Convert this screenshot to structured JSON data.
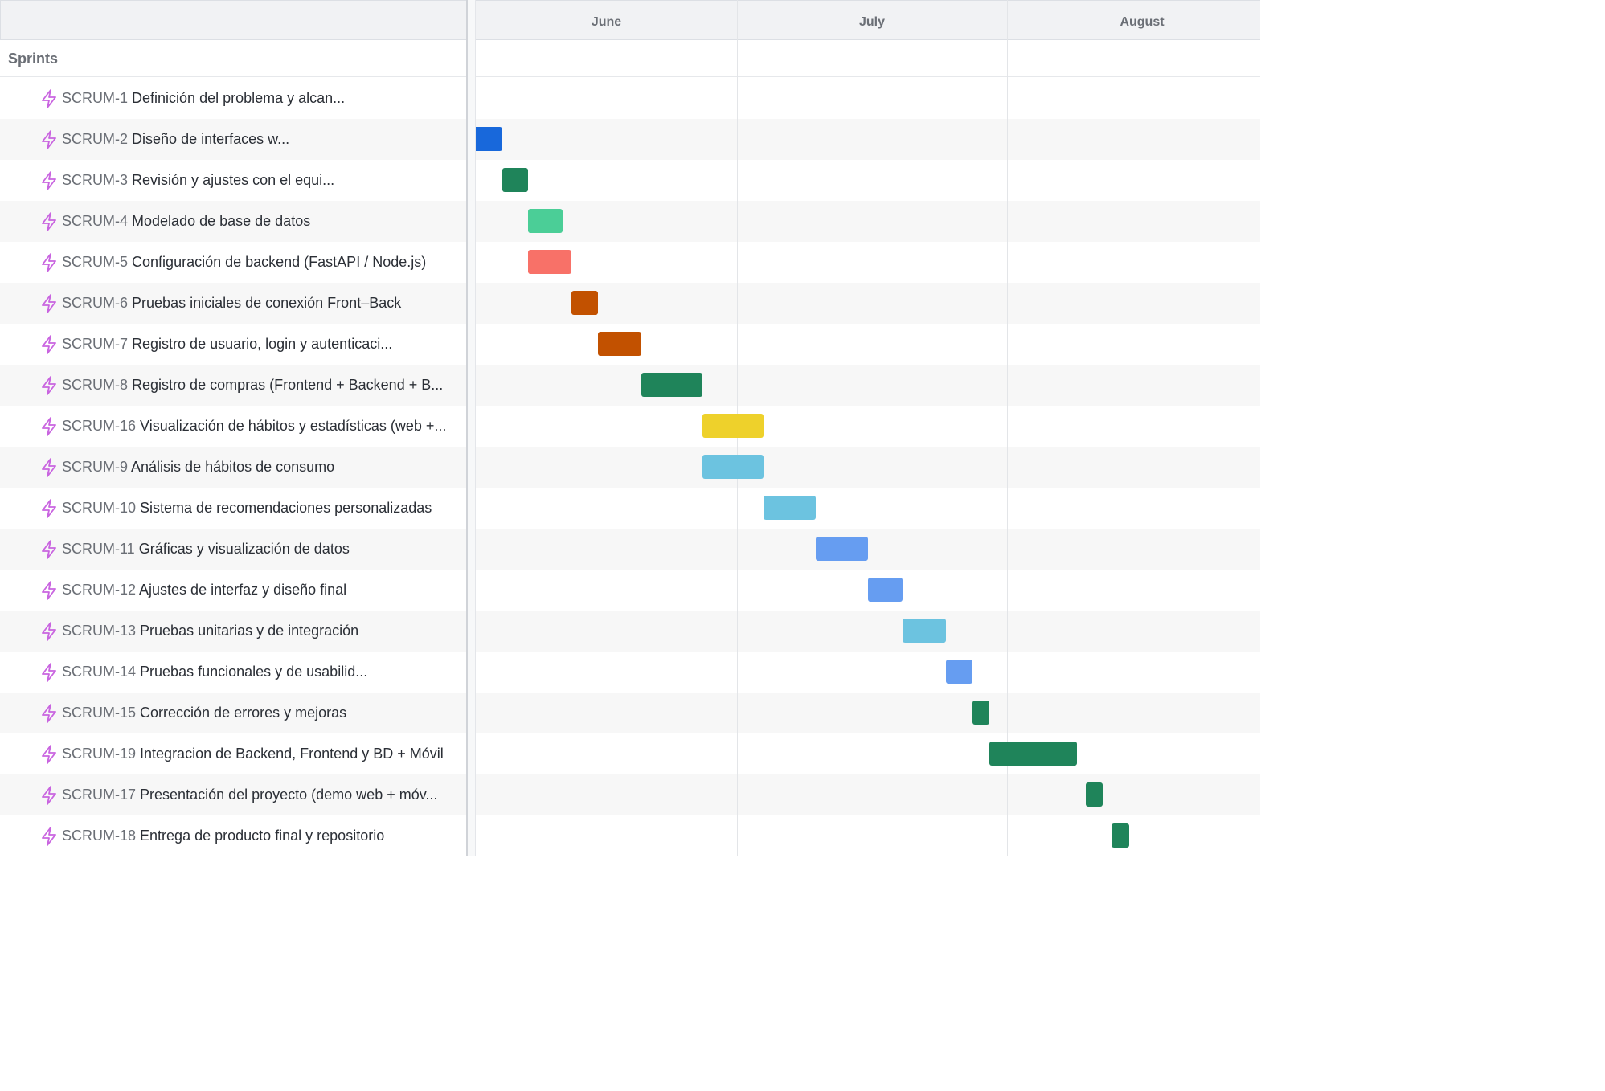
{
  "timeline": {
    "months": [
      "June",
      "July",
      "August"
    ],
    "section_title": "Sprints"
  },
  "issues": [
    {
      "key": "SCRUM-1",
      "title": "Definición del problema y alcan...",
      "start": "",
      "end": "",
      "color": ""
    },
    {
      "key": "SCRUM-2",
      "title": "Diseño de interfaces w...",
      "start": "2025-05-31",
      "end": "2025-06-03",
      "color": "#1868db"
    },
    {
      "key": "SCRUM-3",
      "title": "Revisión y ajustes con el equi...",
      "start": "2025-06-04",
      "end": "2025-06-06",
      "color": "#1f845a"
    },
    {
      "key": "SCRUM-4",
      "title": "Modelado de base de datos",
      "start": "2025-06-07",
      "end": "2025-06-10",
      "color": "#4bce97"
    },
    {
      "key": "SCRUM-5",
      "title": "Configuración de backend (FastAPI / Node.js)",
      "start": "2025-06-07",
      "end": "2025-06-11",
      "color": "#f87168"
    },
    {
      "key": "SCRUM-6",
      "title": "Pruebas iniciales de conexión Front–Back",
      "start": "2025-06-12",
      "end": "2025-06-14",
      "color": "#c25100"
    },
    {
      "key": "SCRUM-7",
      "title": "Registro de usuario, login y autenticaci...",
      "start": "2025-06-15",
      "end": "2025-06-19",
      "color": "#c25100"
    },
    {
      "key": "SCRUM-8",
      "title": "Registro de compras (Frontend + Backend + B...",
      "start": "2025-06-20",
      "end": "2025-06-26",
      "color": "#1f845a"
    },
    {
      "key": "SCRUM-16",
      "title": "Visualización de hábitos y estadísticas (web +...",
      "start": "2025-06-27",
      "end": "2025-07-03",
      "color": "#eed12b"
    },
    {
      "key": "SCRUM-9",
      "title": "Análisis de hábitos de consumo",
      "start": "2025-06-27",
      "end": "2025-07-03",
      "color": "#6cc3e0"
    },
    {
      "key": "SCRUM-10",
      "title": "Sistema de recomendaciones personalizadas",
      "start": "2025-07-04",
      "end": "2025-07-09",
      "color": "#6cc3e0"
    },
    {
      "key": "SCRUM-11",
      "title": "Gráficas y visualización de datos",
      "start": "2025-07-10",
      "end": "2025-07-15",
      "color": "#669df1"
    },
    {
      "key": "SCRUM-12",
      "title": "Ajustes de interfaz y diseño final",
      "start": "2025-07-16",
      "end": "2025-07-19",
      "color": "#669df1"
    },
    {
      "key": "SCRUM-13",
      "title": "Pruebas unitarias y de integración",
      "start": "2025-07-20",
      "end": "2025-07-24",
      "color": "#6cc3e0"
    },
    {
      "key": "SCRUM-14",
      "title": "Pruebas funcionales y de usabilid...",
      "start": "2025-07-25",
      "end": "2025-07-27",
      "color": "#669df1"
    },
    {
      "key": "SCRUM-15",
      "title": "Corrección de errores y mejoras",
      "start": "2025-07-28",
      "end": "2025-07-29",
      "color": "#1f845a"
    },
    {
      "key": "SCRUM-19",
      "title": "Integracion de Backend, Frontend y BD + Móvil",
      "start": "2025-07-30",
      "end": "2025-08-08",
      "color": "#1f845a"
    },
    {
      "key": "SCRUM-17",
      "title": "Presentación del proyecto (demo web + móv...",
      "start": "2025-08-10",
      "end": "2025-08-11",
      "color": "#1f845a"
    },
    {
      "key": "SCRUM-18",
      "title": "Entrega de producto final y repositorio",
      "start": "2025-08-13",
      "end": "2025-08-14",
      "color": "#1f845a"
    }
  ],
  "colors": {
    "bolt": "#c964e0"
  }
}
